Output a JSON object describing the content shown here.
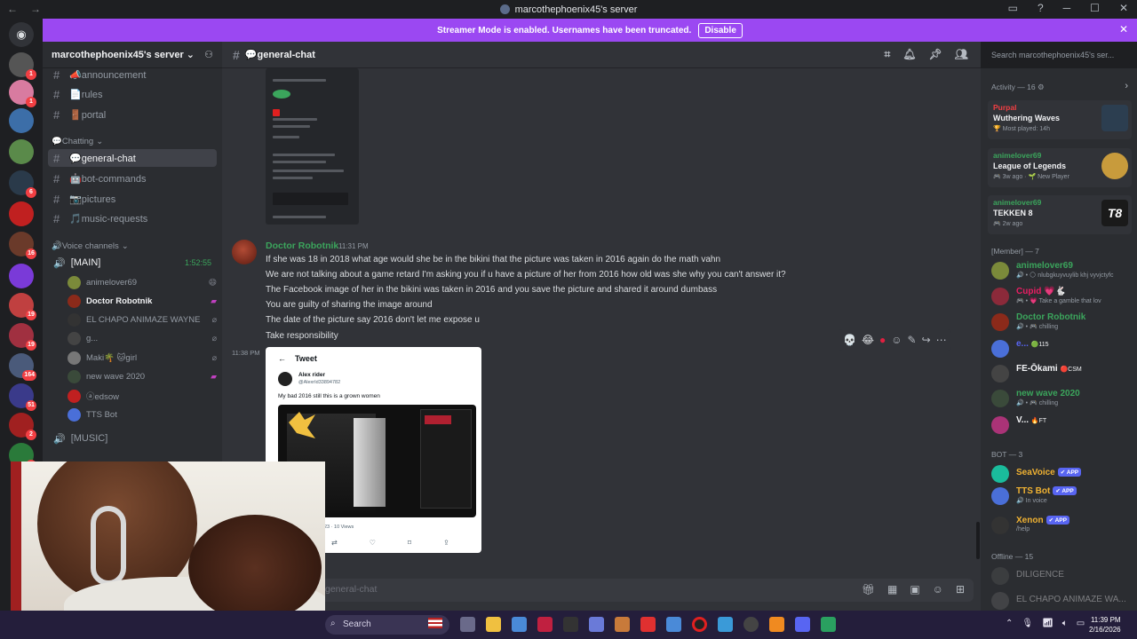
{
  "window": {
    "title": "marcothephoenix45's server"
  },
  "banner": {
    "text": "Streamer Mode is enabled. Usernames have been truncated.",
    "disable_label": "Disable"
  },
  "server": {
    "name": "marcothephoenix45's server"
  },
  "sidebar": {
    "top_channels": [
      {
        "label": "📣announcement"
      },
      {
        "label": "📄rules"
      },
      {
        "label": "🚪portal"
      }
    ],
    "category_chatting": "💬Chatting",
    "chat_channels": [
      {
        "label": "💬general-chat"
      },
      {
        "label": "🤖bot-commands"
      },
      {
        "label": "📷pictures"
      },
      {
        "label": "🎵music-requests"
      }
    ],
    "category_voice": "🔊Voice channels",
    "voice_main": {
      "label": "[MAIN]",
      "timer": "1:52:55"
    },
    "voice_users": [
      {
        "name": "animelover69",
        "color": "#7b8a3a"
      },
      {
        "name": "Doctor Robotnik",
        "color": "#8b2a1a"
      },
      {
        "name": "EL CHAPO ANIMAZE WAYNE",
        "color": "#333"
      },
      {
        "name": "g...",
        "color": "#444"
      },
      {
        "name": "Maki🌴 🐱girl",
        "color": "#777"
      },
      {
        "name": "new wave 2020",
        "color": "#3a4a3a"
      },
      {
        "name": "ⓐedsow",
        "color": "#c02020"
      },
      {
        "name": "TTS Bot",
        "color": "#4a6fd8"
      }
    ],
    "voice_music": {
      "label": "[MUSIC]"
    }
  },
  "chat": {
    "channel": "💬general-chat",
    "author": "Doctor Robotnik",
    "time": "11:31 PM",
    "lines": [
      "If she was 18 in 2018 what age would she be in the bikini that the picture was taken in 2016 again do the math vahn",
      "We are not talking about a game retard I'm asking you if u have a picture of her from 2016 how old was she why you can't answer it?",
      "The Facebook image of her in the bikini was taken in 2016 and you save the picture and shared it around dumbass",
      "You are guilty of sharing the image around",
      "The date of the picture say 2016 don't let me expose u",
      "Take responsibility"
    ],
    "time2": "11:38 PM",
    "tweet": {
      "header": "Tweet",
      "name": "Alex rider",
      "handle": "@AlexrId33894782",
      "text": "My bad 2016 still this is a grown women",
      "views": "23 · 10 Views"
    },
    "composer_placeholder": "general-chat"
  },
  "header_search": {
    "placeholder": "Search marcothephoenix45's ser..."
  },
  "members": {
    "activity_label": "Activity — 16",
    "activities": [
      {
        "user": "Purpal",
        "user_color": "#f23f43",
        "game": "Wuthering Waves",
        "status": "🏆 Most played: 14h",
        "thumb": "#2c3e50"
      },
      {
        "user": "animelover69",
        "user_color": "#3ba55c",
        "game": "League of Legends",
        "status": "🎮 3w ago · 🌱 New Player",
        "thumb": "#c89b3c"
      },
      {
        "user": "animelover69",
        "user_color": "#3ba55c",
        "game": "TEKKEN 8",
        "status": "🎮 2w ago",
        "thumb": "#1a1a1a"
      }
    ],
    "member_label": "[Member] — 7",
    "member_list": [
      {
        "name": "animelover69",
        "color": "#3ba55c",
        "status": "🔊 • 🌕 nlubgkuyvuylib khj vyvjctyfc",
        "av": "#7b8a3a"
      },
      {
        "name": "Cupid 💗🐇",
        "color": "#e91e63",
        "status": "🎮 • 💗 Take a gamble that lov",
        "av": "#8b2a3a"
      },
      {
        "name": "Doctor Robotnik",
        "color": "#3ba55c",
        "status": "🔊 • 🎮 chilling",
        "av": "#8b2a1a"
      },
      {
        "name": "e...",
        "color": "#5865f2",
        "status": "",
        "av": "#4a6fd8"
      },
      {
        "name": "FE-Ōkami",
        "color": "#f2f3f5",
        "status": "",
        "av": "#444"
      },
      {
        "name": "new wave 2020",
        "color": "#3ba55c",
        "status": "🔊 • 🎮 chilling",
        "av": "#3a4a3a"
      },
      {
        "name": "V...",
        "color": "#f2f3f5",
        "status": "",
        "av": "#aa3377"
      }
    ],
    "member_tags": [
      "",
      "",
      "",
      "🟢115",
      "🔴CSM",
      "",
      "🔥FT"
    ],
    "bot_label": "BOT — 3",
    "bots": [
      {
        "name": "SeaVoice",
        "color": "#f0b232",
        "status": "",
        "tag": "✔ APP",
        "av": "#1abc9c"
      },
      {
        "name": "TTS Bot",
        "color": "#f0b232",
        "status": "🔊 In voice",
        "tag": "✔ APP",
        "av": "#4a6fd8"
      },
      {
        "name": "Xenon",
        "color": "#f0b232",
        "status": "/help",
        "tag": "✔ APP",
        "av": "#333"
      }
    ],
    "offline_label": "Offline — 15",
    "offline": [
      {
        "name": "DILIGENCE",
        "av": "#555"
      },
      {
        "name": "EL CHAPO ANIMAZE WA...",
        "av": "#666"
      }
    ]
  },
  "taskbar": {
    "search_label": "Search",
    "time": "11:39 PM",
    "date": "2/16/2026"
  }
}
